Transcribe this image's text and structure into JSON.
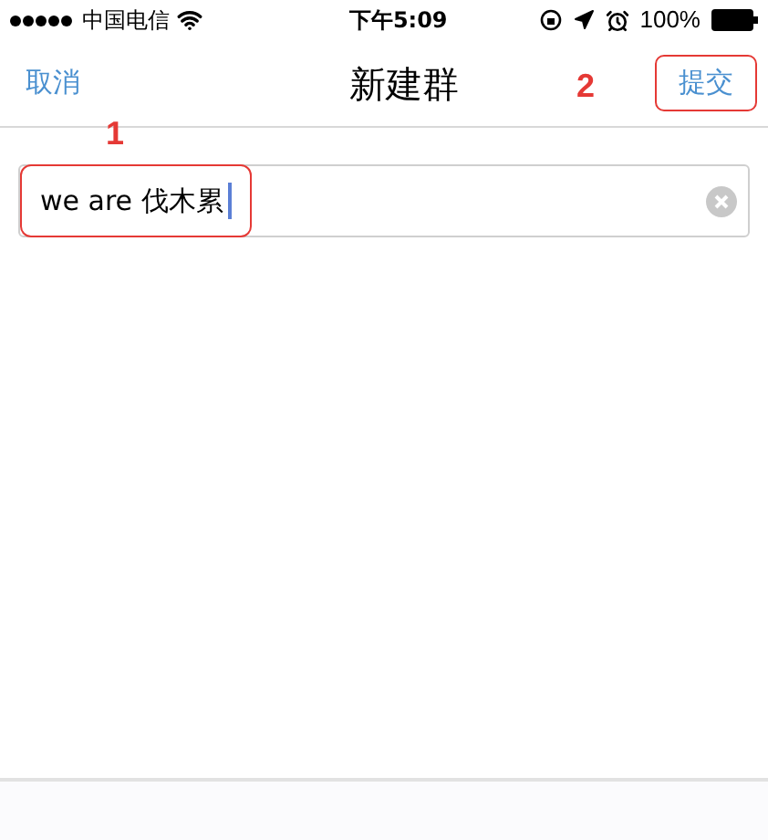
{
  "status_bar": {
    "carrier": "中国电信",
    "time": "下午5:09",
    "battery": "100%"
  },
  "nav": {
    "cancel": "取消",
    "title": "新建群",
    "submit": "提交"
  },
  "field": {
    "value": "we are 伐木累"
  },
  "annotations": [
    {
      "label": "1"
    },
    {
      "label": "2"
    }
  ]
}
